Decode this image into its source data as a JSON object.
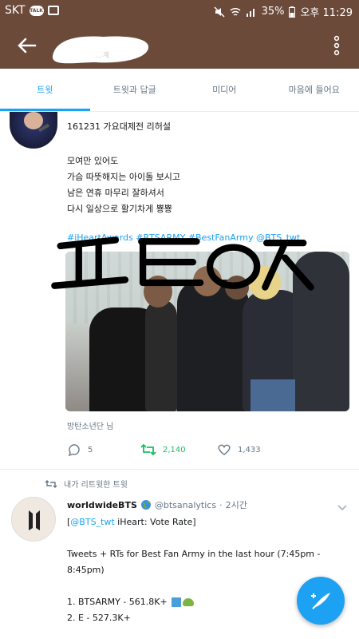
{
  "status_bar": {
    "carrier": "SKT",
    "talk_badge": "TALK",
    "battery": "35%",
    "time": "오후 11:29"
  },
  "app_bar": {
    "title_partial": "...계"
  },
  "tabs": [
    {
      "label": "트윗",
      "active": true
    },
    {
      "label": "트윗과 답글",
      "active": false
    },
    {
      "label": "미디어",
      "active": false
    },
    {
      "label": "마음에 들어요",
      "active": false
    }
  ],
  "tweet1": {
    "title": "161231 가요대제전 리허설",
    "lines": [
      "모여만 있어도",
      "가슴 따뜻해지는 아이돌 보시고",
      "남은 연휴 마무리 잘하셔서",
      "다시 일상으로 활기차게 뿅뿅"
    ],
    "hashtags": "#iHeartAwards #BTSARMY #BestFanArmy @BTS_twt",
    "image_caption": "방탄소년단 님",
    "reply_count": "5",
    "retweet_count": "2,140",
    "like_count": "1,433",
    "retweeted": true
  },
  "tweet2": {
    "retweet_context": "내가 리트윗한 트윗",
    "author_name": "worldwideBTS",
    "handle": "@btsanalytics",
    "time": "2시간",
    "mention": "@BTS_twt",
    "line1_rest": " iHeart: Vote Rate]",
    "line1_open": "[",
    "body_lines": [
      "Tweets + RTs for Best Fan Army in the last hour (7:45pm -",
      "8:45pm)"
    ],
    "rank1": "1. BTSARMY - 561.8K+",
    "rank2": "2. E - 527.3K+"
  },
  "colors": {
    "app_bar": "#6b4a3a",
    "accent": "#1da1f2",
    "retweet_green": "#17bf63",
    "secondary_text": "#657786"
  }
}
